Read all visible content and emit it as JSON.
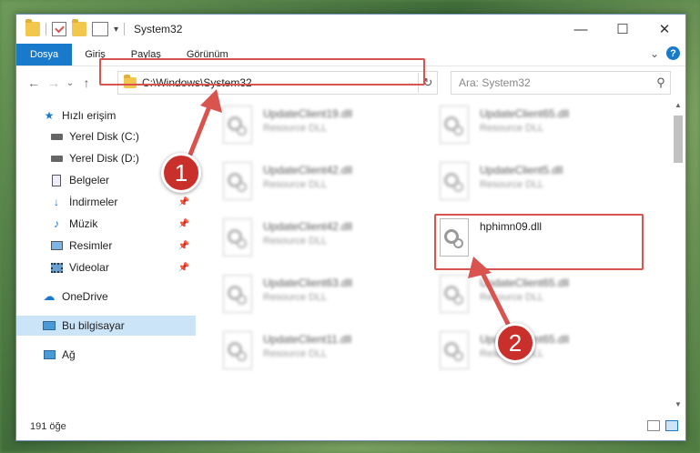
{
  "window": {
    "title": "System32",
    "controls": {
      "minimize": "—",
      "maximize": "☐",
      "close": "✕"
    }
  },
  "ribbon": {
    "tabs": [
      {
        "label": "Dosya",
        "active": true
      },
      {
        "label": "Giriş"
      },
      {
        "label": "Paylaş"
      },
      {
        "label": "Görünüm"
      }
    ],
    "help": "?",
    "collapse": "⌄"
  },
  "navigation": {
    "back": "←",
    "forward": "→",
    "recent": "⌄",
    "up": "↑"
  },
  "address": {
    "path": "C:\\Windows\\System32",
    "dropdown": "⌄",
    "refresh": "↻"
  },
  "search": {
    "placeholder": "Ara: System32"
  },
  "sidebar": {
    "items": [
      {
        "label": "Hızlı erişim",
        "icon": "star-icon"
      },
      {
        "label": "Yerel Disk (C:)",
        "icon": "drive-icon"
      },
      {
        "label": "Yerel Disk (D:)",
        "icon": "drive-icon"
      },
      {
        "label": "Belgeler",
        "icon": "documents-icon"
      },
      {
        "label": "İndirmeler",
        "icon": "download-icon"
      },
      {
        "label": "Müzik",
        "icon": "music-icon"
      },
      {
        "label": "Resimler",
        "icon": "pictures-icon"
      },
      {
        "label": "Videolar",
        "icon": "videos-icon"
      },
      {
        "label": "OneDrive",
        "icon": "cloud-icon"
      },
      {
        "label": "Bu bilgisayar",
        "icon": "computer-icon",
        "selected": true
      },
      {
        "label": "Ağ",
        "icon": "network-icon"
      }
    ]
  },
  "files": [
    {
      "name": "UpdateClient19.dll",
      "type": "Resource DLL"
    },
    {
      "name": "UpdateClient65.dll",
      "type": "Resource DLL"
    },
    {
      "name": "UpdateClient42.dll",
      "type": "Resource DLL"
    },
    {
      "name": "UpdateClient5.dll",
      "type": "Resource DLL"
    },
    {
      "name": "UpdateClient42.dll",
      "type": "Resource DLL"
    },
    {
      "name": "hphimn09.dll",
      "type": ""
    },
    {
      "name": "UpdateClient63.dll",
      "type": "Resource DLL"
    },
    {
      "name": "UpdateClient65.dll",
      "type": "Resource DLL"
    },
    {
      "name": "UpdateClient11.dll",
      "type": "Resource DLL"
    },
    {
      "name": "UpdateClient65.dll",
      "type": "Resource DLL"
    }
  ],
  "status": {
    "count": "191 öğe"
  },
  "callouts": {
    "one": "1",
    "two": "2"
  },
  "colors": {
    "accent": "#1979ca",
    "highlight": "#d9534f"
  }
}
